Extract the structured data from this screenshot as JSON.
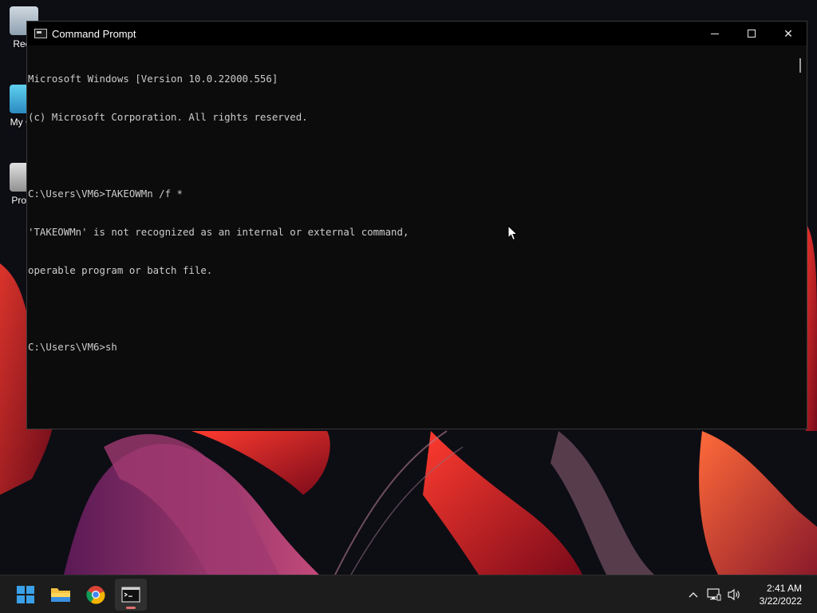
{
  "desktop": {
    "icons": [
      {
        "label": "Recy",
        "icon": "recycle-bin-icon"
      },
      {
        "label": "My Co",
        "icon": "computer-icon"
      },
      {
        "label": "Proce",
        "icon": "process-monitor-icon"
      }
    ]
  },
  "window": {
    "title": "Command Prompt",
    "minimize_symbol": "—",
    "close_symbol": "✕",
    "lines": [
      "Microsoft Windows [Version 10.0.22000.556]",
      "(c) Microsoft Corporation. All rights reserved.",
      "",
      "C:\\Users\\VM6>TAKEOWMn /f *",
      "'TAKEOWMn' is not recognized as an internal or external command,",
      "operable program or batch file.",
      "",
      "C:\\Users\\VM6>sh"
    ]
  },
  "taskbar": {
    "apps": [
      {
        "name": "start",
        "icon": "windows-start-icon"
      },
      {
        "name": "file-explorer",
        "icon": "folder-icon"
      },
      {
        "name": "chrome",
        "icon": "chrome-icon"
      },
      {
        "name": "command-prompt",
        "icon": "terminal-icon",
        "active": true
      }
    ],
    "tray": {
      "chevron": "^",
      "time": "2:41 AM",
      "date": "3/22/2022"
    }
  },
  "colors": {
    "console_bg": "#0c0c0c",
    "console_text": "#cccccc",
    "taskbar_bg": "#1c1c1c",
    "accent": "#3aa0e8"
  }
}
